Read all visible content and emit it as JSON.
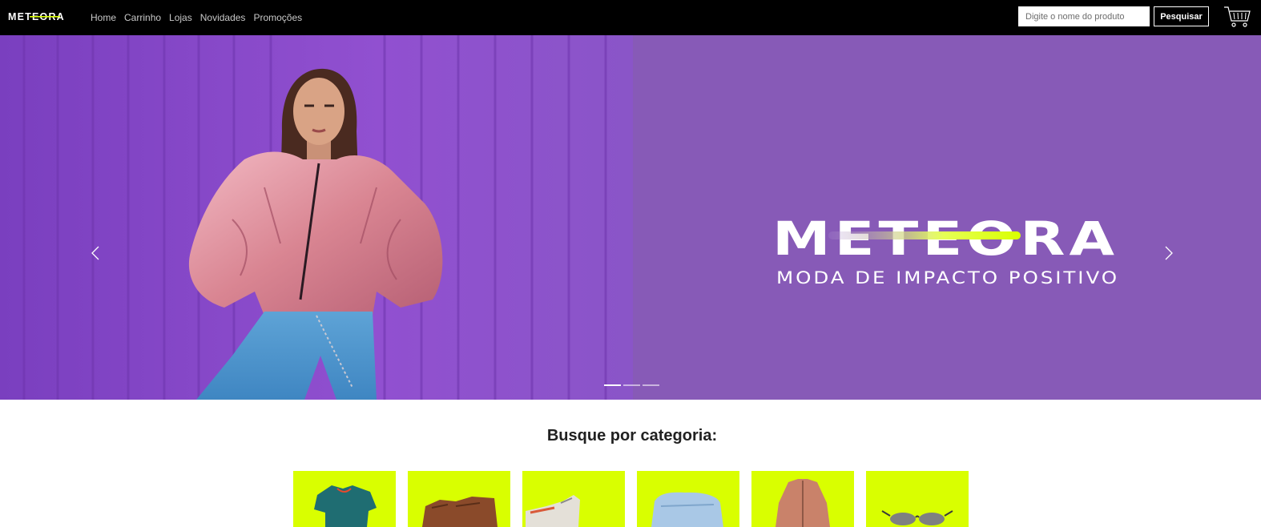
{
  "header": {
    "logo": "METEORA",
    "nav": [
      "Home",
      "Carrinho",
      "Lojas",
      "Novidades",
      "Promoções"
    ],
    "search_placeholder": "Digite o nome do produto",
    "search_button": "Pesquisar",
    "cart_icon": "cart-icon"
  },
  "hero": {
    "brand_name": "METEORA",
    "tagline": "MODA DE IMPACTO POSITIVO",
    "slide_count": 3,
    "active_slide": 1,
    "background_color": "#875ab7",
    "accent_color": "#d9ff00"
  },
  "categories": {
    "title": "Busque por categoria:",
    "items": [
      {
        "icon": "tshirt-icon"
      },
      {
        "icon": "bag-icon"
      },
      {
        "icon": "sneaker-icon"
      },
      {
        "icon": "jeans-icon"
      },
      {
        "icon": "jacket-icon"
      },
      {
        "icon": "sunglasses-icon"
      }
    ]
  }
}
